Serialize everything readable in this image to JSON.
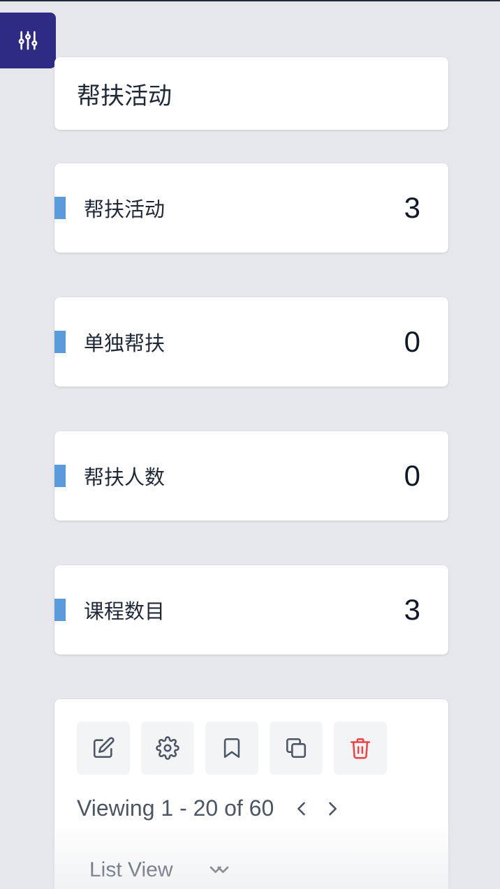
{
  "filter_button": {
    "icon": "sliders-icon"
  },
  "header": {
    "title": "帮扶活动"
  },
  "stats": [
    {
      "label": "帮扶活动",
      "value": "3"
    },
    {
      "label": "单独帮扶",
      "value": "0"
    },
    {
      "label": "帮扶人数",
      "value": "0"
    },
    {
      "label": "课程数目",
      "value": "3"
    }
  ],
  "toolbar": {
    "actions": [
      {
        "icon": "edit-icon"
      },
      {
        "icon": "gear-icon"
      },
      {
        "icon": "bookmark-icon"
      },
      {
        "icon": "copy-icon"
      },
      {
        "icon": "trash-icon",
        "color": "#ef4444"
      }
    ]
  },
  "pagination": {
    "text": "Viewing 1 - 20 of 60"
  },
  "view_selector": {
    "label": "List View"
  },
  "colors": {
    "accent_dark": "#2e2b85",
    "stat_bar": "#5a9bdc",
    "danger": "#ef4444",
    "page_bg": "#e5e7eb"
  }
}
